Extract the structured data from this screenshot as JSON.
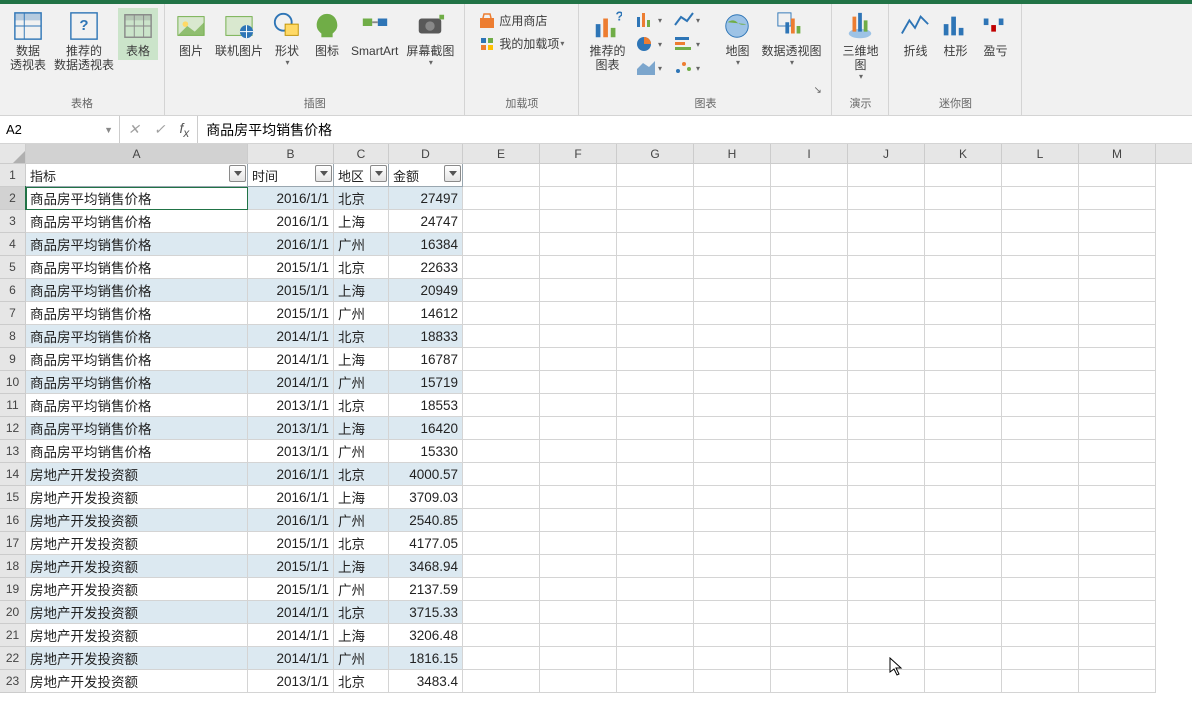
{
  "namebox": "A2",
  "formula": "商品房平均销售价格",
  "ribbon": {
    "tables": {
      "pivot": "数据\n透视表",
      "rec_pivot": "推荐的\n数据透视表",
      "table": "表格",
      "label": "表格"
    },
    "illus": {
      "pic": "图片",
      "online_pic": "联机图片",
      "shapes": "形状",
      "icons": "图标",
      "smartart": "SmartArt",
      "screenshot": "屏幕截图",
      "label": "插图"
    },
    "addins": {
      "store": "应用商店",
      "myaddins": "我的加载项",
      "label": "加载项"
    },
    "charts": {
      "rec": "推荐的\n图表",
      "map": "地图",
      "pivotchart": "数据透视图",
      "label": "图表"
    },
    "tours": {
      "map3d": "三维地\n图",
      "label": "演示"
    },
    "spark": {
      "line": "折线",
      "column": "柱形",
      "winloss": "盈亏",
      "label": "迷你图"
    }
  },
  "columns": [
    "E",
    "F",
    "G",
    "H",
    "I",
    "J",
    "K",
    "L",
    "M"
  ],
  "table_headers": {
    "A": "指标",
    "B": "时间",
    "C": "地区",
    "D": "金额"
  },
  "rows": [
    {
      "n": 2,
      "a": "商品房平均销售价格",
      "b": "2016/1/1",
      "c": "北京",
      "d": "27497"
    },
    {
      "n": 3,
      "a": "商品房平均销售价格",
      "b": "2016/1/1",
      "c": "上海",
      "d": "24747"
    },
    {
      "n": 4,
      "a": "商品房平均销售价格",
      "b": "2016/1/1",
      "c": "广州",
      "d": "16384"
    },
    {
      "n": 5,
      "a": "商品房平均销售价格",
      "b": "2015/1/1",
      "c": "北京",
      "d": "22633"
    },
    {
      "n": 6,
      "a": "商品房平均销售价格",
      "b": "2015/1/1",
      "c": "上海",
      "d": "20949"
    },
    {
      "n": 7,
      "a": "商品房平均销售价格",
      "b": "2015/1/1",
      "c": "广州",
      "d": "14612"
    },
    {
      "n": 8,
      "a": "商品房平均销售价格",
      "b": "2014/1/1",
      "c": "北京",
      "d": "18833"
    },
    {
      "n": 9,
      "a": "商品房平均销售价格",
      "b": "2014/1/1",
      "c": "上海",
      "d": "16787"
    },
    {
      "n": 10,
      "a": "商品房平均销售价格",
      "b": "2014/1/1",
      "c": "广州",
      "d": "15719"
    },
    {
      "n": 11,
      "a": "商品房平均销售价格",
      "b": "2013/1/1",
      "c": "北京",
      "d": "18553"
    },
    {
      "n": 12,
      "a": "商品房平均销售价格",
      "b": "2013/1/1",
      "c": "上海",
      "d": "16420"
    },
    {
      "n": 13,
      "a": "商品房平均销售价格",
      "b": "2013/1/1",
      "c": "广州",
      "d": "15330"
    },
    {
      "n": 14,
      "a": "房地产开发投资额",
      "b": "2016/1/1",
      "c": "北京",
      "d": "4000.57"
    },
    {
      "n": 15,
      "a": "房地产开发投资额",
      "b": "2016/1/1",
      "c": "上海",
      "d": "3709.03"
    },
    {
      "n": 16,
      "a": "房地产开发投资额",
      "b": "2016/1/1",
      "c": "广州",
      "d": "2540.85"
    },
    {
      "n": 17,
      "a": "房地产开发投资额",
      "b": "2015/1/1",
      "c": "北京",
      "d": "4177.05"
    },
    {
      "n": 18,
      "a": "房地产开发投资额",
      "b": "2015/1/1",
      "c": "上海",
      "d": "3468.94"
    },
    {
      "n": 19,
      "a": "房地产开发投资额",
      "b": "2015/1/1",
      "c": "广州",
      "d": "2137.59"
    },
    {
      "n": 20,
      "a": "房地产开发投资额",
      "b": "2014/1/1",
      "c": "北京",
      "d": "3715.33"
    },
    {
      "n": 21,
      "a": "房地产开发投资额",
      "b": "2014/1/1",
      "c": "上海",
      "d": "3206.48"
    },
    {
      "n": 22,
      "a": "房地产开发投资额",
      "b": "2014/1/1",
      "c": "广州",
      "d": "1816.15"
    },
    {
      "n": 23,
      "a": "房地产开发投资额",
      "b": "2013/1/1",
      "c": "北京",
      "d": "3483.4"
    }
  ]
}
